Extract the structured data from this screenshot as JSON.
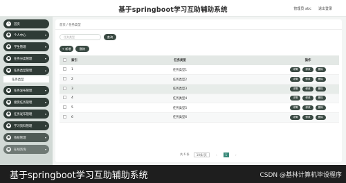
{
  "header": {
    "title": "基于springboot学习互助辅助系统",
    "user": "管理员 abc",
    "logout": "退出登录"
  },
  "sidebar": {
    "items": [
      {
        "label": "首页",
        "icon": "home-icon"
      },
      {
        "label": "个人中心",
        "icon": "user-icon"
      },
      {
        "label": "学生管理",
        "icon": "student-icon"
      },
      {
        "label": "任务分类管理",
        "icon": "folder-icon"
      },
      {
        "label": "任务类型管理",
        "icon": "list-icon"
      },
      {
        "label": "任务发布管理",
        "icon": "send-icon"
      },
      {
        "label": "接受任务管理",
        "icon": "inbox-icon"
      },
      {
        "label": "任务发布管理",
        "icon": "task-icon"
      },
      {
        "label": "学习资料管理",
        "icon": "book-icon"
      },
      {
        "label": "系统管理",
        "icon": "gear-icon"
      },
      {
        "label": "在线咨询",
        "icon": "chat-icon"
      }
    ],
    "active_sub": "任务类型"
  },
  "breadcrumb": {
    "home": "首页",
    "sep": "/",
    "current": "任务类型"
  },
  "search": {
    "placeholder": "任务类型",
    "button": "查询"
  },
  "actions": {
    "add": "+ 新增",
    "delete": "删除"
  },
  "table": {
    "headers": {
      "index": "索引",
      "type": "任务类型",
      "ops": "操作"
    },
    "rows": [
      {
        "index": "1",
        "type": "任务类型1"
      },
      {
        "index": "2",
        "type": "任务类型2"
      },
      {
        "index": "3",
        "type": "任务类型3"
      },
      {
        "index": "4",
        "type": "任务类型4"
      },
      {
        "index": "5",
        "type": "任务类型5"
      },
      {
        "index": "6",
        "type": "任务类型6"
      }
    ],
    "op_labels": {
      "detail": "详情",
      "edit": "修改",
      "delete": "删除"
    }
  },
  "pager": {
    "total": "共 6 条",
    "size": "10条/页",
    "prev": "‹",
    "current": "1",
    "next": "›"
  },
  "caption": {
    "text": "基于springboot学习互助辅助系统",
    "source": "CSDN @基林计算机毕设程序"
  }
}
